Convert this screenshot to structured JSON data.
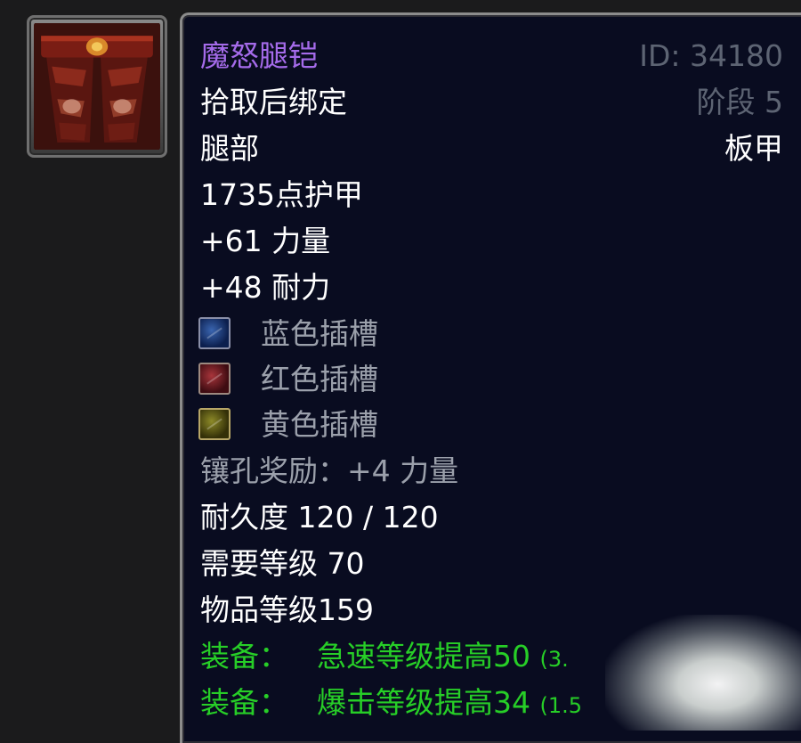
{
  "item": {
    "name": "魔怒腿铠",
    "id_label": "ID: 34180",
    "bind": "拾取后绑定",
    "phase": "阶段 5",
    "slot": "腿部",
    "armor_type": "板甲",
    "armor": "1735点护甲",
    "stat_strength": "+61 力量",
    "stat_stamina": "+48 耐力",
    "sockets": [
      {
        "color": "blue",
        "label": "蓝色插槽"
      },
      {
        "color": "red",
        "label": "红色插槽"
      },
      {
        "color": "yellow",
        "label": "黄色插槽"
      }
    ],
    "socket_bonus": "镶孔奖励：+4 力量",
    "durability": "耐久度 120 / 120",
    "required_level": "需要等级 70",
    "item_level": "物品等级159",
    "equip_effects": [
      {
        "prefix": "装备：",
        "text": "急速等级提高50",
        "extra": "(3."
      },
      {
        "prefix": "装备：",
        "text": "爆击等级提高34",
        "extra": "(1.5"
      }
    ]
  },
  "icon_name": "plate-legs-icon",
  "colors": {
    "name_epic": "#a56bea",
    "equip_green": "#27ce27",
    "muted_gray": "#5d6473"
  }
}
